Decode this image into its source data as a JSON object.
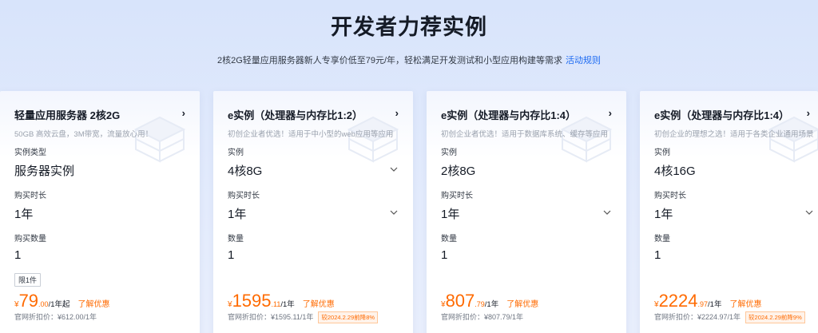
{
  "header": {
    "title": "开发者力荐实例",
    "subtitle": "2核2G轻量应用服务器新人专享价低至79元/年，轻松满足开发测试和小型应用构建等需求",
    "rules_link": "活动规则"
  },
  "cards": [
    {
      "title": "轻量应用服务器 2核2G",
      "desc": "50GB 高效云盘，3M带宽，流量放心用！",
      "field1_label": "实例类型",
      "field1_value": "服务器实例",
      "field2_label": "购买时长",
      "field2_value": "1年",
      "field3_label": "购买数量",
      "field3_value": "1",
      "limit_tag": "限1件",
      "yen": "¥",
      "price": "79",
      "cents": ".00",
      "unit": "/1年起",
      "more": "了解优惠",
      "original": "官网折扣价：¥612.00/1年"
    },
    {
      "title": "e实例（处理器与内存比1:2）",
      "desc": "初创企业者优选！适用于中小型的web应用等应用",
      "field1_label": "实例",
      "field1_value": "4核8G",
      "field2_label": "购买时长",
      "field2_value": "1年",
      "field3_label": "数量",
      "field3_value": "1",
      "yen": "¥",
      "price": "1595",
      "cents": ".11",
      "unit": "/1年",
      "more": "了解优惠",
      "badge": "较2024.2.29前降8%",
      "original": "官网折扣价：¥1595.11/1年"
    },
    {
      "title": "e实例（处理器与内存比1:4）",
      "desc": "初创企业者优选！适用于数据库系统、缓存等应用",
      "field1_label": "实例",
      "field1_value": "2核8G",
      "field2_label": "购买时长",
      "field2_value": "1年",
      "field3_label": "数量",
      "field3_value": "1",
      "yen": "¥",
      "price": "807",
      "cents": ".79",
      "unit": "/1年",
      "more": "了解优惠",
      "original": "官网折扣价：¥807.79/1年"
    },
    {
      "title": "e实例（处理器与内存比1:4）",
      "desc": "初创企业的理想之选！适用于各类企业通用场景",
      "field1_label": "实例",
      "field1_value": "4核16G",
      "field2_label": "购买时长",
      "field2_value": "1年",
      "field3_label": "数量",
      "field3_value": "1",
      "yen": "¥",
      "price": "2224",
      "cents": ".97",
      "unit": "/1年",
      "more": "了解优惠",
      "badge": "较2024.2.29前降9%",
      "original": "官网折扣价：¥2224.97/1年"
    }
  ],
  "colors": {
    "accent": "#ff6a00",
    "link": "#1d6af2"
  },
  "icons": {
    "arrow": "chevron-right-icon",
    "dropdown": "chevron-down-icon"
  }
}
